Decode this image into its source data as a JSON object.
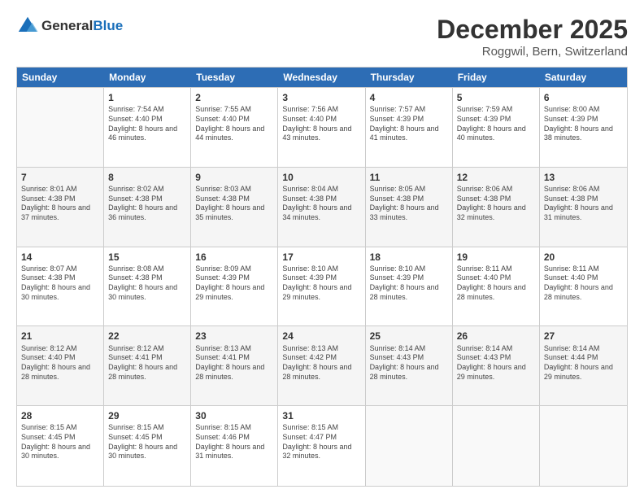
{
  "logo": {
    "line1": "General",
    "line2": "Blue"
  },
  "title": "December 2025",
  "location": "Roggwil, Bern, Switzerland",
  "header_days": [
    "Sunday",
    "Monday",
    "Tuesday",
    "Wednesday",
    "Thursday",
    "Friday",
    "Saturday"
  ],
  "weeks": [
    [
      {
        "day": "",
        "sunrise": "",
        "sunset": "",
        "daylight": ""
      },
      {
        "day": "1",
        "sunrise": "Sunrise: 7:54 AM",
        "sunset": "Sunset: 4:40 PM",
        "daylight": "Daylight: 8 hours and 46 minutes."
      },
      {
        "day": "2",
        "sunrise": "Sunrise: 7:55 AM",
        "sunset": "Sunset: 4:40 PM",
        "daylight": "Daylight: 8 hours and 44 minutes."
      },
      {
        "day": "3",
        "sunrise": "Sunrise: 7:56 AM",
        "sunset": "Sunset: 4:40 PM",
        "daylight": "Daylight: 8 hours and 43 minutes."
      },
      {
        "day": "4",
        "sunrise": "Sunrise: 7:57 AM",
        "sunset": "Sunset: 4:39 PM",
        "daylight": "Daylight: 8 hours and 41 minutes."
      },
      {
        "day": "5",
        "sunrise": "Sunrise: 7:59 AM",
        "sunset": "Sunset: 4:39 PM",
        "daylight": "Daylight: 8 hours and 40 minutes."
      },
      {
        "day": "6",
        "sunrise": "Sunrise: 8:00 AM",
        "sunset": "Sunset: 4:39 PM",
        "daylight": "Daylight: 8 hours and 38 minutes."
      }
    ],
    [
      {
        "day": "7",
        "sunrise": "Sunrise: 8:01 AM",
        "sunset": "Sunset: 4:38 PM",
        "daylight": "Daylight: 8 hours and 37 minutes."
      },
      {
        "day": "8",
        "sunrise": "Sunrise: 8:02 AM",
        "sunset": "Sunset: 4:38 PM",
        "daylight": "Daylight: 8 hours and 36 minutes."
      },
      {
        "day": "9",
        "sunrise": "Sunrise: 8:03 AM",
        "sunset": "Sunset: 4:38 PM",
        "daylight": "Daylight: 8 hours and 35 minutes."
      },
      {
        "day": "10",
        "sunrise": "Sunrise: 8:04 AM",
        "sunset": "Sunset: 4:38 PM",
        "daylight": "Daylight: 8 hours and 34 minutes."
      },
      {
        "day": "11",
        "sunrise": "Sunrise: 8:05 AM",
        "sunset": "Sunset: 4:38 PM",
        "daylight": "Daylight: 8 hours and 33 minutes."
      },
      {
        "day": "12",
        "sunrise": "Sunrise: 8:06 AM",
        "sunset": "Sunset: 4:38 PM",
        "daylight": "Daylight: 8 hours and 32 minutes."
      },
      {
        "day": "13",
        "sunrise": "Sunrise: 8:06 AM",
        "sunset": "Sunset: 4:38 PM",
        "daylight": "Daylight: 8 hours and 31 minutes."
      }
    ],
    [
      {
        "day": "14",
        "sunrise": "Sunrise: 8:07 AM",
        "sunset": "Sunset: 4:38 PM",
        "daylight": "Daylight: 8 hours and 30 minutes."
      },
      {
        "day": "15",
        "sunrise": "Sunrise: 8:08 AM",
        "sunset": "Sunset: 4:38 PM",
        "daylight": "Daylight: 8 hours and 30 minutes."
      },
      {
        "day": "16",
        "sunrise": "Sunrise: 8:09 AM",
        "sunset": "Sunset: 4:39 PM",
        "daylight": "Daylight: 8 hours and 29 minutes."
      },
      {
        "day": "17",
        "sunrise": "Sunrise: 8:10 AM",
        "sunset": "Sunset: 4:39 PM",
        "daylight": "Daylight: 8 hours and 29 minutes."
      },
      {
        "day": "18",
        "sunrise": "Sunrise: 8:10 AM",
        "sunset": "Sunset: 4:39 PM",
        "daylight": "Daylight: 8 hours and 28 minutes."
      },
      {
        "day": "19",
        "sunrise": "Sunrise: 8:11 AM",
        "sunset": "Sunset: 4:40 PM",
        "daylight": "Daylight: 8 hours and 28 minutes."
      },
      {
        "day": "20",
        "sunrise": "Sunrise: 8:11 AM",
        "sunset": "Sunset: 4:40 PM",
        "daylight": "Daylight: 8 hours and 28 minutes."
      }
    ],
    [
      {
        "day": "21",
        "sunrise": "Sunrise: 8:12 AM",
        "sunset": "Sunset: 4:40 PM",
        "daylight": "Daylight: 8 hours and 28 minutes."
      },
      {
        "day": "22",
        "sunrise": "Sunrise: 8:12 AM",
        "sunset": "Sunset: 4:41 PM",
        "daylight": "Daylight: 8 hours and 28 minutes."
      },
      {
        "day": "23",
        "sunrise": "Sunrise: 8:13 AM",
        "sunset": "Sunset: 4:41 PM",
        "daylight": "Daylight: 8 hours and 28 minutes."
      },
      {
        "day": "24",
        "sunrise": "Sunrise: 8:13 AM",
        "sunset": "Sunset: 4:42 PM",
        "daylight": "Daylight: 8 hours and 28 minutes."
      },
      {
        "day": "25",
        "sunrise": "Sunrise: 8:14 AM",
        "sunset": "Sunset: 4:43 PM",
        "daylight": "Daylight: 8 hours and 28 minutes."
      },
      {
        "day": "26",
        "sunrise": "Sunrise: 8:14 AM",
        "sunset": "Sunset: 4:43 PM",
        "daylight": "Daylight: 8 hours and 29 minutes."
      },
      {
        "day": "27",
        "sunrise": "Sunrise: 8:14 AM",
        "sunset": "Sunset: 4:44 PM",
        "daylight": "Daylight: 8 hours and 29 minutes."
      }
    ],
    [
      {
        "day": "28",
        "sunrise": "Sunrise: 8:15 AM",
        "sunset": "Sunset: 4:45 PM",
        "daylight": "Daylight: 8 hours and 30 minutes."
      },
      {
        "day": "29",
        "sunrise": "Sunrise: 8:15 AM",
        "sunset": "Sunset: 4:45 PM",
        "daylight": "Daylight: 8 hours and 30 minutes."
      },
      {
        "day": "30",
        "sunrise": "Sunrise: 8:15 AM",
        "sunset": "Sunset: 4:46 PM",
        "daylight": "Daylight: 8 hours and 31 minutes."
      },
      {
        "day": "31",
        "sunrise": "Sunrise: 8:15 AM",
        "sunset": "Sunset: 4:47 PM",
        "daylight": "Daylight: 8 hours and 32 minutes."
      },
      {
        "day": "",
        "sunrise": "",
        "sunset": "",
        "daylight": ""
      },
      {
        "day": "",
        "sunrise": "",
        "sunset": "",
        "daylight": ""
      },
      {
        "day": "",
        "sunrise": "",
        "sunset": "",
        "daylight": ""
      }
    ]
  ]
}
